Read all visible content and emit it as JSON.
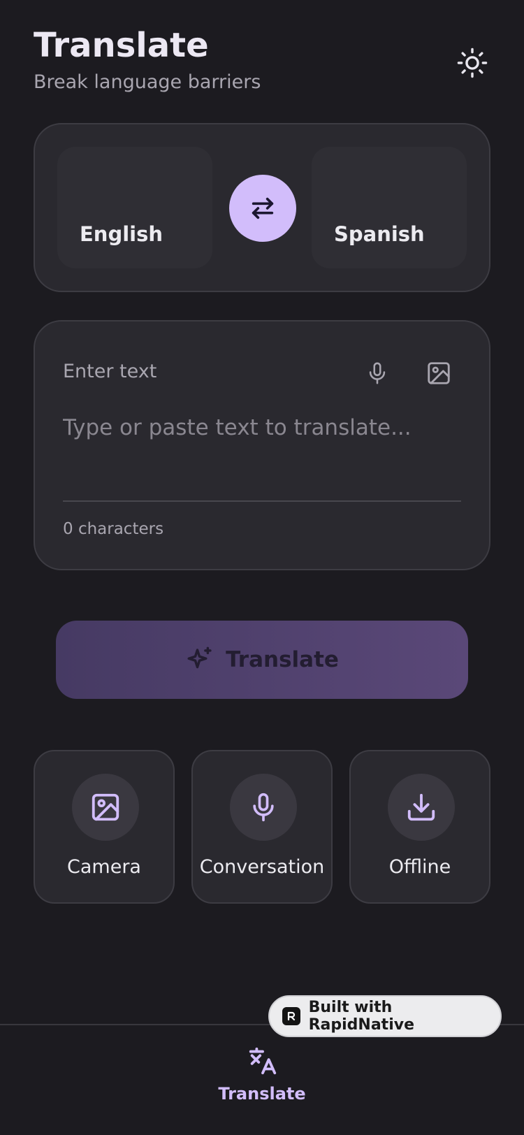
{
  "header": {
    "title": "Translate",
    "subtitle": "Break language barriers",
    "theme_icon": "sun-icon"
  },
  "languages": {
    "source": "English",
    "target": "Spanish",
    "swap_icon": "swap-arrows-icon"
  },
  "input": {
    "label": "Enter text",
    "placeholder": "Type or paste text to translate...",
    "value": "",
    "char_count": "0 characters",
    "mic_icon": "microphone-icon",
    "image_icon": "image-icon"
  },
  "translate_button": {
    "label": "Translate",
    "icon": "sparkles-icon"
  },
  "features": [
    {
      "label": "Camera",
      "icon": "image-icon"
    },
    {
      "label": "Conversation",
      "icon": "microphone-icon"
    },
    {
      "label": "Offline",
      "icon": "download-icon"
    }
  ],
  "bottom_nav": {
    "items": [
      {
        "label": "Translate",
        "icon": "translate-icon",
        "active": true
      }
    ]
  },
  "badge": {
    "label": "Built with RapidNative"
  },
  "colors": {
    "background": "#1c1b20",
    "card": "#2a292f",
    "accent": "#d2bdfb",
    "button_gradient_start": "#463a63",
    "button_gradient_end": "#5a4878"
  }
}
